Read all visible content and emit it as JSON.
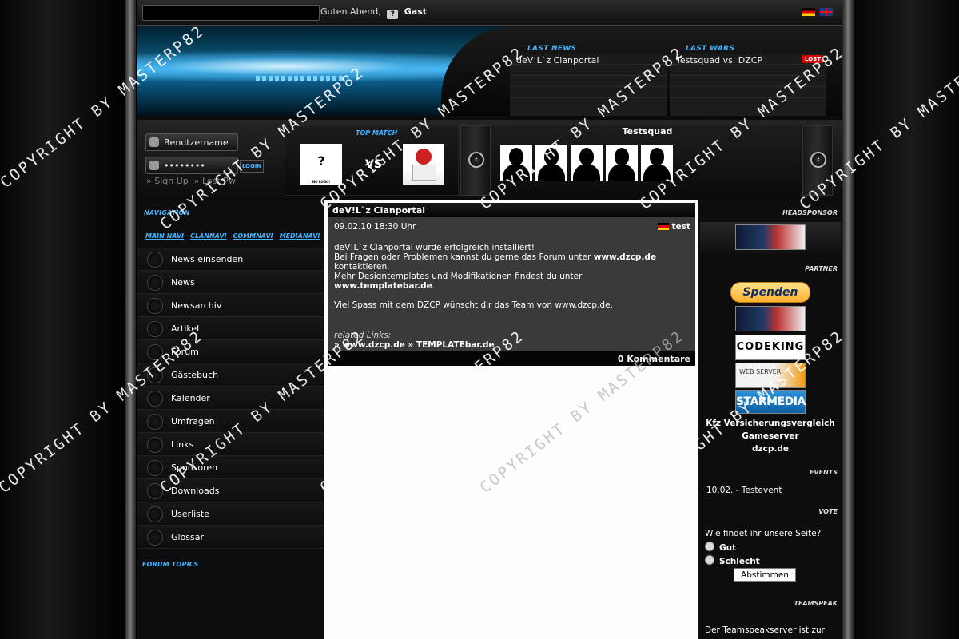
{
  "topbar": {
    "greeting": "Guten Abend,",
    "user_icon": "?",
    "user": "Gast"
  },
  "header": {
    "last_news_title": "LAST NEWS",
    "last_news_item": "deV!L`z Clanportal",
    "last_wars_title": "LAST WARS",
    "last_wars_item": "Testsquad vs. DZCP",
    "war_result": "LOST"
  },
  "login": {
    "username": "Benutzername",
    "password": "••••••••",
    "button": "LOGIN",
    "signup": "» Sign Up",
    "lostpw": "» Lost Pw"
  },
  "topmatch": {
    "title": "TOP MATCH",
    "team_a": "?",
    "team_a_sub": "NO LOGO!",
    "vs": "VS"
  },
  "squad": {
    "name": "Testsquad",
    "members": 5
  },
  "nav": {
    "title": "NAVIGATION",
    "tabs": [
      "MAIN NAVI",
      "CLANNAVI",
      "COMMNAVI",
      "MEDIANAVI"
    ],
    "items": [
      "News einsenden",
      "News",
      "Newsarchiv",
      "Artikel",
      "Forum",
      "Gästebuch",
      "Kalender",
      "Umfragen",
      "Links",
      "Sponsoren",
      "Downloads",
      "Userliste",
      "Glossar"
    ],
    "forum_topics": "FORUM TOPICS"
  },
  "post": {
    "title": "deV!L`z Clanportal",
    "date": "09.02.10 18:30 Uhr",
    "author": "test",
    "line1": "deV!L`z Clanportal wurde erfolgreich installiert!",
    "line2a": "Bei Fragen oder Problemen kannst du gerne das Forum unter ",
    "line2b": "www.dzcp.de",
    "line3": "kontaktieren.",
    "line4": "Mehr Designtemplates und Modifikationen findest du unter",
    "line5": "www.templatebar.de",
    "line6": "Viel Spass mit dem DZCP wünscht dir das Team von www.dzcp.de.",
    "related_label": "related Links:",
    "related_links": "» www.dzcp.de » TEMPLATEbar.de",
    "comments": "0 Kommentare"
  },
  "right": {
    "headsponsor": "HEADSPONSOR",
    "partner": "PARTNER",
    "spenden": "Spenden",
    "codeking": "CODEKING",
    "webserver": "WEB SERVER",
    "starmedia": "STARMEDIA",
    "links": [
      "Kfz Versicherungsvergleich",
      "Gameserver",
      "dzcp.de"
    ],
    "events_title": "EVENTS",
    "event": "10.02. - Testevent",
    "vote_title": "VOTE",
    "vote_question": "Wie findet ihr unsere Seite?",
    "vote_options": [
      "Gut",
      "Schlecht"
    ],
    "vote_button": "Abstimmen",
    "teamspeak_title": "TEAMSPEAK",
    "teamspeak_text": "Der Teamspeakserver ist zur"
  },
  "watermark": "COPYRIGHT BY MASTERP82"
}
